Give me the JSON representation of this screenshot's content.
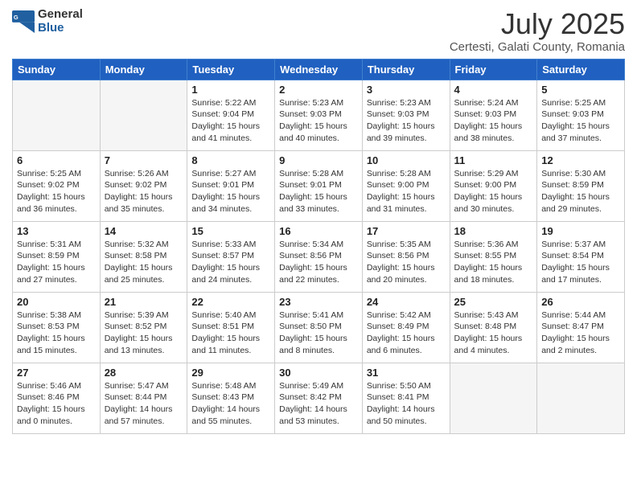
{
  "logo": {
    "general": "General",
    "blue": "Blue"
  },
  "title": "July 2025",
  "subtitle": "Certesti, Galati County, Romania",
  "days_of_week": [
    "Sunday",
    "Monday",
    "Tuesday",
    "Wednesday",
    "Thursday",
    "Friday",
    "Saturday"
  ],
  "weeks": [
    [
      {
        "num": "",
        "info": ""
      },
      {
        "num": "",
        "info": ""
      },
      {
        "num": "1",
        "info": "Sunrise: 5:22 AM\nSunset: 9:04 PM\nDaylight: 15 hours and 41 minutes."
      },
      {
        "num": "2",
        "info": "Sunrise: 5:23 AM\nSunset: 9:03 PM\nDaylight: 15 hours and 40 minutes."
      },
      {
        "num": "3",
        "info": "Sunrise: 5:23 AM\nSunset: 9:03 PM\nDaylight: 15 hours and 39 minutes."
      },
      {
        "num": "4",
        "info": "Sunrise: 5:24 AM\nSunset: 9:03 PM\nDaylight: 15 hours and 38 minutes."
      },
      {
        "num": "5",
        "info": "Sunrise: 5:25 AM\nSunset: 9:03 PM\nDaylight: 15 hours and 37 minutes."
      }
    ],
    [
      {
        "num": "6",
        "info": "Sunrise: 5:25 AM\nSunset: 9:02 PM\nDaylight: 15 hours and 36 minutes."
      },
      {
        "num": "7",
        "info": "Sunrise: 5:26 AM\nSunset: 9:02 PM\nDaylight: 15 hours and 35 minutes."
      },
      {
        "num": "8",
        "info": "Sunrise: 5:27 AM\nSunset: 9:01 PM\nDaylight: 15 hours and 34 minutes."
      },
      {
        "num": "9",
        "info": "Sunrise: 5:28 AM\nSunset: 9:01 PM\nDaylight: 15 hours and 33 minutes."
      },
      {
        "num": "10",
        "info": "Sunrise: 5:28 AM\nSunset: 9:00 PM\nDaylight: 15 hours and 31 minutes."
      },
      {
        "num": "11",
        "info": "Sunrise: 5:29 AM\nSunset: 9:00 PM\nDaylight: 15 hours and 30 minutes."
      },
      {
        "num": "12",
        "info": "Sunrise: 5:30 AM\nSunset: 8:59 PM\nDaylight: 15 hours and 29 minutes."
      }
    ],
    [
      {
        "num": "13",
        "info": "Sunrise: 5:31 AM\nSunset: 8:59 PM\nDaylight: 15 hours and 27 minutes."
      },
      {
        "num": "14",
        "info": "Sunrise: 5:32 AM\nSunset: 8:58 PM\nDaylight: 15 hours and 25 minutes."
      },
      {
        "num": "15",
        "info": "Sunrise: 5:33 AM\nSunset: 8:57 PM\nDaylight: 15 hours and 24 minutes."
      },
      {
        "num": "16",
        "info": "Sunrise: 5:34 AM\nSunset: 8:56 PM\nDaylight: 15 hours and 22 minutes."
      },
      {
        "num": "17",
        "info": "Sunrise: 5:35 AM\nSunset: 8:56 PM\nDaylight: 15 hours and 20 minutes."
      },
      {
        "num": "18",
        "info": "Sunrise: 5:36 AM\nSunset: 8:55 PM\nDaylight: 15 hours and 18 minutes."
      },
      {
        "num": "19",
        "info": "Sunrise: 5:37 AM\nSunset: 8:54 PM\nDaylight: 15 hours and 17 minutes."
      }
    ],
    [
      {
        "num": "20",
        "info": "Sunrise: 5:38 AM\nSunset: 8:53 PM\nDaylight: 15 hours and 15 minutes."
      },
      {
        "num": "21",
        "info": "Sunrise: 5:39 AM\nSunset: 8:52 PM\nDaylight: 15 hours and 13 minutes."
      },
      {
        "num": "22",
        "info": "Sunrise: 5:40 AM\nSunset: 8:51 PM\nDaylight: 15 hours and 11 minutes."
      },
      {
        "num": "23",
        "info": "Sunrise: 5:41 AM\nSunset: 8:50 PM\nDaylight: 15 hours and 8 minutes."
      },
      {
        "num": "24",
        "info": "Sunrise: 5:42 AM\nSunset: 8:49 PM\nDaylight: 15 hours and 6 minutes."
      },
      {
        "num": "25",
        "info": "Sunrise: 5:43 AM\nSunset: 8:48 PM\nDaylight: 15 hours and 4 minutes."
      },
      {
        "num": "26",
        "info": "Sunrise: 5:44 AM\nSunset: 8:47 PM\nDaylight: 15 hours and 2 minutes."
      }
    ],
    [
      {
        "num": "27",
        "info": "Sunrise: 5:46 AM\nSunset: 8:46 PM\nDaylight: 15 hours and 0 minutes."
      },
      {
        "num": "28",
        "info": "Sunrise: 5:47 AM\nSunset: 8:44 PM\nDaylight: 14 hours and 57 minutes."
      },
      {
        "num": "29",
        "info": "Sunrise: 5:48 AM\nSunset: 8:43 PM\nDaylight: 14 hours and 55 minutes."
      },
      {
        "num": "30",
        "info": "Sunrise: 5:49 AM\nSunset: 8:42 PM\nDaylight: 14 hours and 53 minutes."
      },
      {
        "num": "31",
        "info": "Sunrise: 5:50 AM\nSunset: 8:41 PM\nDaylight: 14 hours and 50 minutes."
      },
      {
        "num": "",
        "info": ""
      },
      {
        "num": "",
        "info": ""
      }
    ]
  ]
}
